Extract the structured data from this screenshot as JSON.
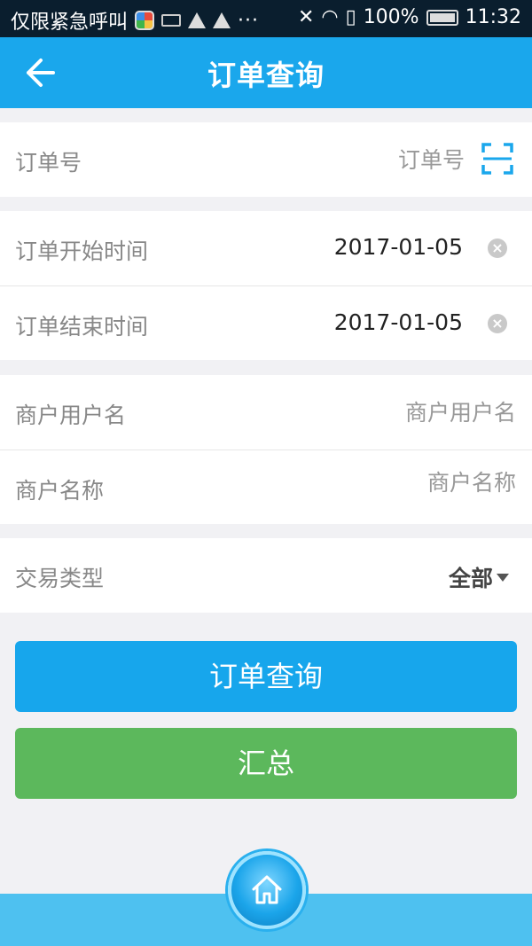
{
  "status_bar": {
    "carrier": "仅限紧急呼叫",
    "more": "···",
    "battery": "100%",
    "time": "11:32"
  },
  "header": {
    "title": "订单查询",
    "back_icon": "arrow-left-icon"
  },
  "form": {
    "order_no": {
      "label": "订单号",
      "placeholder": "订单号",
      "icon": "scan-icon"
    },
    "start_time": {
      "label": "订单开始时间",
      "value": "2017-01-05"
    },
    "end_time": {
      "label": "订单结束时间",
      "value": "2017-01-05"
    },
    "merchant_username": {
      "label": "商户用户名",
      "placeholder": "商户用户名"
    },
    "merchant_name": {
      "label": "商户名称",
      "placeholder": "商户名称"
    },
    "trade_type": {
      "label": "交易类型",
      "value": "全部"
    }
  },
  "buttons": {
    "query_label": "订单查询",
    "summary_label": "汇总"
  },
  "colors": {
    "accent": "#1aa7ec",
    "summary": "#5cb85c",
    "bottom_bar": "#4ec1f0"
  },
  "bottom": {
    "home_icon": "home-icon"
  }
}
